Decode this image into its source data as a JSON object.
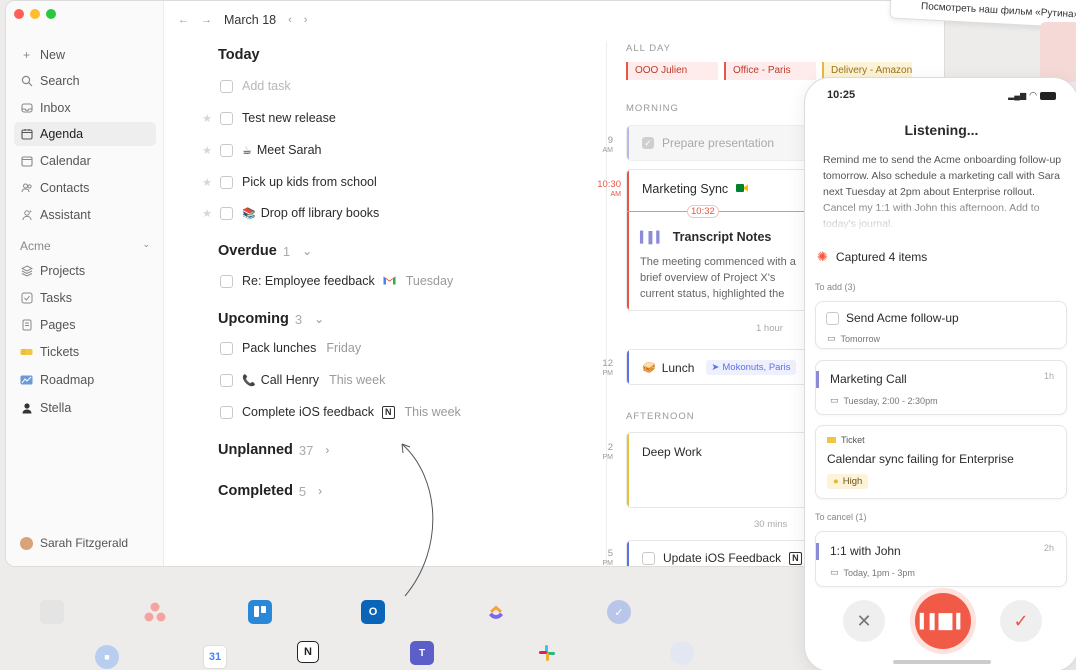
{
  "sidebar": {
    "items": [
      {
        "label": "New",
        "icon": "plus-icon"
      },
      {
        "label": "Search",
        "icon": "search-icon"
      },
      {
        "label": "Inbox",
        "icon": "inbox-icon"
      },
      {
        "label": "Agenda",
        "icon": "agenda-icon"
      },
      {
        "label": "Calendar",
        "icon": "calendar-icon"
      },
      {
        "label": "Contacts",
        "icon": "contacts-icon"
      },
      {
        "label": "Assistant",
        "icon": "assistant-icon"
      }
    ],
    "workspace": "Acme",
    "workspace_items": [
      {
        "label": "Projects",
        "icon": "projects-icon"
      },
      {
        "label": "Tasks",
        "icon": "tasks-icon"
      },
      {
        "label": "Pages",
        "icon": "pages-icon"
      },
      {
        "label": "Tickets",
        "icon": "tickets-icon"
      },
      {
        "label": "Roadmap",
        "icon": "roadmap-icon"
      },
      {
        "label": "Stella",
        "icon": "stella-icon"
      }
    ],
    "user": "Sarah Fitzgerald"
  },
  "header": {
    "date": "March 18"
  },
  "today": {
    "title": "Today",
    "add_task": "Add task",
    "tasks": [
      {
        "label": "Test new release"
      },
      {
        "label": "Meet Sarah",
        "emoji": "☕"
      },
      {
        "label": "Pick up kids from school"
      },
      {
        "label": "Drop off library books",
        "emoji": "📚"
      }
    ]
  },
  "overdue": {
    "title": "Overdue",
    "count": "1",
    "tasks": [
      {
        "label": "Re: Employee feedback",
        "meta": "Tuesday"
      }
    ]
  },
  "upcoming": {
    "title": "Upcoming",
    "count": "3",
    "tasks": [
      {
        "label": "Pack lunches",
        "meta": "Friday"
      },
      {
        "label": "Call Henry",
        "meta": "This week",
        "emoji": "📞"
      },
      {
        "label": "Complete iOS feedback",
        "meta": "This week"
      }
    ]
  },
  "unplanned": {
    "title": "Unplanned",
    "count": "37"
  },
  "completed": {
    "title": "Completed",
    "count": "5"
  },
  "calendar": {
    "all_day_label": "ALL DAY",
    "all_day": [
      "OOO Julien",
      "Office - Paris",
      "Delivery - Amazon"
    ],
    "morning_label": "MORNING",
    "afternoon_label": "AFTERNOON",
    "hours": [
      {
        "num": "9",
        "ampm": "AM"
      },
      {
        "num": "10:30",
        "ampm": "AM"
      },
      {
        "num": "12",
        "ampm": "PM"
      },
      {
        "num": "2",
        "ampm": "PM"
      },
      {
        "num": "5",
        "ampm": "PM"
      }
    ],
    "events": {
      "prepare": "Prepare presentation",
      "marketing": "Marketing Sync",
      "now_time": "10:32",
      "transcript_title": "Transcript Notes",
      "transcript_body": "The meeting commenced with a brief overview of Project X's current status, highlighted the successful completion",
      "lunch": "Lunch",
      "lunch_location": "Mokonuts, Paris",
      "deep_work": "Deep Work",
      "update_ios": "Update iOS Feedback"
    },
    "gap_1h": "1 hour",
    "gap_30m": "30 mins"
  },
  "phone": {
    "time": "10:25",
    "title": "Listening...",
    "transcript": "Remind me to send the Acme onboarding follow-up tomorrow. Also schedule a marketing call with Sara next Tuesday at 2pm about Enterprise rollout. Cancel my 1:1 with John this afternoon. Add to today's journal.",
    "captured": "Captured 4 items",
    "to_add": "To add (3)",
    "card1_title": "Send Acme follow-up",
    "card1_meta": "Tomorrow",
    "card2_title": "Marketing Call",
    "card2_meta": "Tuesday, 2:00 - 2:30pm",
    "card2_dur": "1h",
    "card3_tag": "Ticket",
    "card3_title": "Calendar sync failing for Enterprise",
    "card3_priority": "High",
    "to_cancel": "To cancel (1)",
    "card4_title": "1:1 with John",
    "card4_meta": "Today, 1pm - 3pm",
    "card4_dur": "2h"
  },
  "promo": "Посмотреть наш фильм «Рутина»",
  "dock": {
    "calendar_date": "31",
    "outlook_letter": "O",
    "notion_letter": "N"
  },
  "colors": {
    "accent_red": "#f05a47",
    "event_red": "#e8564a",
    "lunch_blue": "#5b73e8"
  }
}
